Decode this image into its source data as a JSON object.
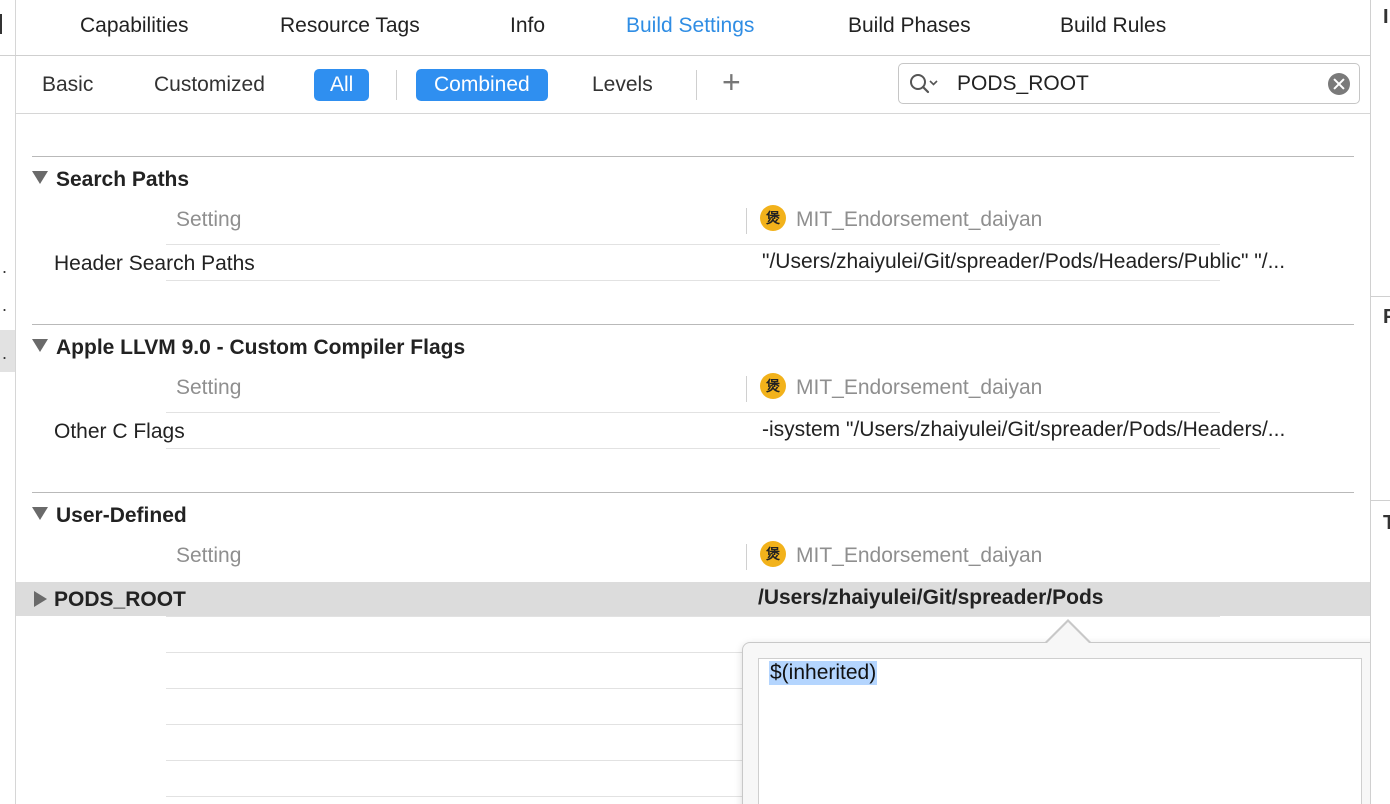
{
  "tabs": [
    "Capabilities",
    "Resource Tags",
    "Info",
    "Build Settings",
    "Build Phases",
    "Build Rules"
  ],
  "active_tab": "Build Settings",
  "filters": {
    "basic": "Basic",
    "customized": "Customized",
    "all": "All",
    "combined": "Combined",
    "levels": "Levels",
    "add": "+"
  },
  "search": {
    "value": "PODS_ROOT"
  },
  "accent_color": "#2f8de4",
  "target_name": "MIT_Endorsement_daiyan",
  "target_icon_glyph": "煲",
  "column_setting": "Setting",
  "sections": [
    {
      "title": "Search Paths",
      "rows": [
        {
          "label": "Header Search Paths",
          "value": "\"/Users/zhaiyulei/Git/spreader/Pods/Headers/Public\" \"/..."
        }
      ]
    },
    {
      "title": "Apple LLVM 9.0 - Custom Compiler Flags",
      "rows": [
        {
          "label": "Other C Flags",
          "value": "-isystem \"/Users/zhaiyulei/Git/spreader/Pods/Headers/..."
        }
      ]
    },
    {
      "title": "User-Defined",
      "rows": [
        {
          "label": "PODS_ROOT",
          "value": "/Users/zhaiyulei/Git/spreader/Pods"
        }
      ]
    }
  ],
  "popover": {
    "text": "$(inherited)"
  },
  "right_panel_letters": [
    "I",
    "P",
    "T"
  ]
}
